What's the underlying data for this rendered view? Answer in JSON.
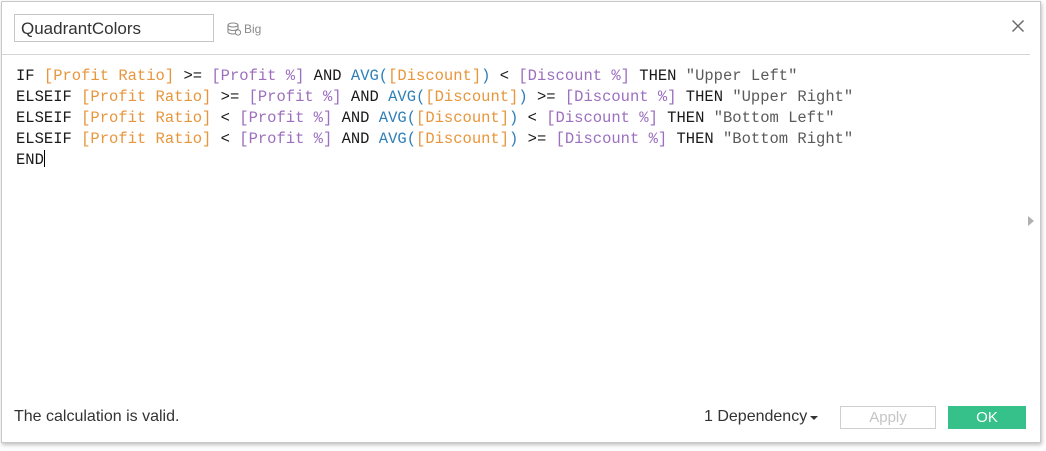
{
  "dialog": {
    "calc_name": "QuadrantColors",
    "datasource_label": "Big"
  },
  "editor": {
    "lines": [
      [
        {
          "t": "kw",
          "v": "IF "
        },
        {
          "t": "field",
          "v": "[Profit Ratio]"
        },
        {
          "t": "op",
          "v": " >= "
        },
        {
          "t": "param",
          "v": "[Profit %]"
        },
        {
          "t": "kw",
          "v": " AND "
        },
        {
          "t": "fn",
          "v": "AVG("
        },
        {
          "t": "field",
          "v": "[Discount]"
        },
        {
          "t": "fn",
          "v": ")"
        },
        {
          "t": "op",
          "v": " < "
        },
        {
          "t": "param",
          "v": "[Discount %]"
        },
        {
          "t": "kw",
          "v": " THEN "
        },
        {
          "t": "str",
          "v": "\"Upper Left\""
        }
      ],
      [
        {
          "t": "kw",
          "v": "ELSEIF "
        },
        {
          "t": "field",
          "v": "[Profit Ratio]"
        },
        {
          "t": "op",
          "v": " >= "
        },
        {
          "t": "param",
          "v": "[Profit %]"
        },
        {
          "t": "kw",
          "v": " AND "
        },
        {
          "t": "fn",
          "v": "AVG("
        },
        {
          "t": "field",
          "v": "[Discount]"
        },
        {
          "t": "fn",
          "v": ")"
        },
        {
          "t": "op",
          "v": " >= "
        },
        {
          "t": "param",
          "v": "[Discount %]"
        },
        {
          "t": "kw",
          "v": " THEN "
        },
        {
          "t": "str",
          "v": "\"Upper Right\""
        }
      ],
      [
        {
          "t": "kw",
          "v": "ELSEIF "
        },
        {
          "t": "field",
          "v": "[Profit Ratio]"
        },
        {
          "t": "op",
          "v": " < "
        },
        {
          "t": "param",
          "v": "[Profit %]"
        },
        {
          "t": "kw",
          "v": " AND "
        },
        {
          "t": "fn",
          "v": "AVG("
        },
        {
          "t": "field",
          "v": "[Discount]"
        },
        {
          "t": "fn",
          "v": ")"
        },
        {
          "t": "op",
          "v": " < "
        },
        {
          "t": "param",
          "v": "[Discount %]"
        },
        {
          "t": "kw",
          "v": " THEN "
        },
        {
          "t": "str",
          "v": "\"Bottom Left\""
        }
      ],
      [
        {
          "t": "kw",
          "v": "ELSEIF "
        },
        {
          "t": "field",
          "v": "[Profit Ratio]"
        },
        {
          "t": "op",
          "v": " < "
        },
        {
          "t": "param",
          "v": "[Profit %]"
        },
        {
          "t": "kw",
          "v": " AND "
        },
        {
          "t": "fn",
          "v": "AVG("
        },
        {
          "t": "field",
          "v": "[Discount]"
        },
        {
          "t": "fn",
          "v": ")"
        },
        {
          "t": "op",
          "v": " >= "
        },
        {
          "t": "param",
          "v": "[Discount %]"
        },
        {
          "t": "kw",
          "v": " THEN "
        },
        {
          "t": "str",
          "v": "\"Bottom Right\""
        }
      ],
      [
        {
          "t": "kw",
          "v": "END"
        }
      ]
    ],
    "colors": {
      "keyword": "#1a1a1a",
      "field": "#e8963c",
      "parameter": "#9c6fbf",
      "function": "#2e7fb8",
      "string": "#5a5a5a"
    }
  },
  "footer": {
    "status": "The calculation is valid.",
    "dependency_label": "1 Dependency",
    "apply_label": "Apply",
    "ok_label": "OK",
    "ok_color": "#36c08a"
  },
  "icons": {
    "datasource": "database-icon",
    "close": "close-icon",
    "expand": "chevron-right-icon",
    "dependency_dropdown": "caret-down-icon"
  }
}
